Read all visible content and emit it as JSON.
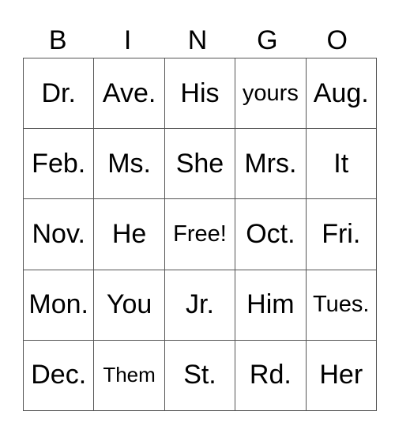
{
  "header": [
    "B",
    "I",
    "N",
    "G",
    "O"
  ],
  "rows": [
    [
      "Dr.",
      "Ave.",
      "His",
      "yours",
      "Aug."
    ],
    [
      "Feb.",
      "Ms.",
      "She",
      "Mrs.",
      "It"
    ],
    [
      "Nov.",
      "He",
      "Free!",
      "Oct.",
      "Fri."
    ],
    [
      "Mon.",
      "You",
      "Jr.",
      "Him",
      "Tues."
    ],
    [
      "Dec.",
      "Them",
      "St.",
      "Rd.",
      "Her"
    ]
  ]
}
